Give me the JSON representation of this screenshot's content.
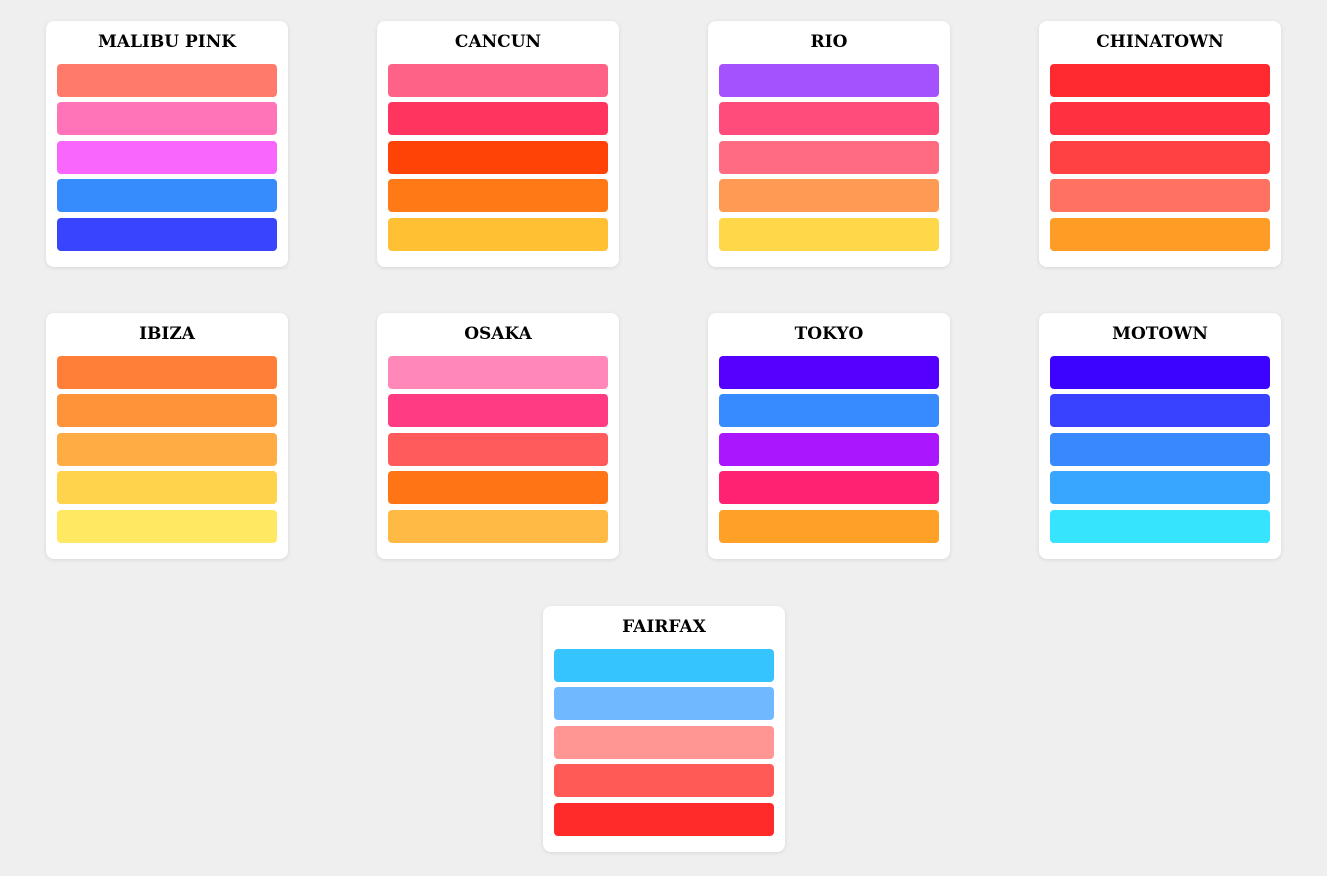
{
  "palettes": [
    {
      "name": "MALIBU PINK",
      "colors": [
        "#ff7a6a",
        "#ff73b9",
        "#f866fd",
        "#368cfd",
        "#3944fd"
      ]
    },
    {
      "name": "CANCUN",
      "colors": [
        "#ff6287",
        "#ff355f",
        "#ff4306",
        "#ff7a16",
        "#ffc034"
      ]
    },
    {
      "name": "RIO",
      "colors": [
        "#a352fe",
        "#ff4c7b",
        "#ff6b81",
        "#ff9a55",
        "#fed849"
      ]
    },
    {
      "name": "CHINATOWN",
      "colors": [
        "#ff2a30",
        "#ff303f",
        "#ff4144",
        "#ff7262",
        "#ff9c26"
      ]
    },
    {
      "name": "IBIZA",
      "colors": [
        "#ff7f38",
        "#ff9339",
        "#ffac44",
        "#ffd34b",
        "#ffe963"
      ]
    },
    {
      "name": "OSAKA",
      "colors": [
        "#ff88b8",
        "#ff3c83",
        "#ff5a5c",
        "#ff7414",
        "#ffba46"
      ]
    },
    {
      "name": "TOKYO",
      "colors": [
        "#5500ff",
        "#378bfe",
        "#aa16fe",
        "#ff2172",
        "#ffa126"
      ]
    },
    {
      "name": "MOTOWN",
      "colors": [
        "#3c03fe",
        "#3942fe",
        "#3888fe",
        "#38a6fe",
        "#37e4fe"
      ]
    },
    {
      "name": "FAIRFAX",
      "colors": [
        "#36c4fe",
        "#70b8ff",
        "#ff9693",
        "#ff5a55",
        "#ff2a2a"
      ]
    }
  ]
}
